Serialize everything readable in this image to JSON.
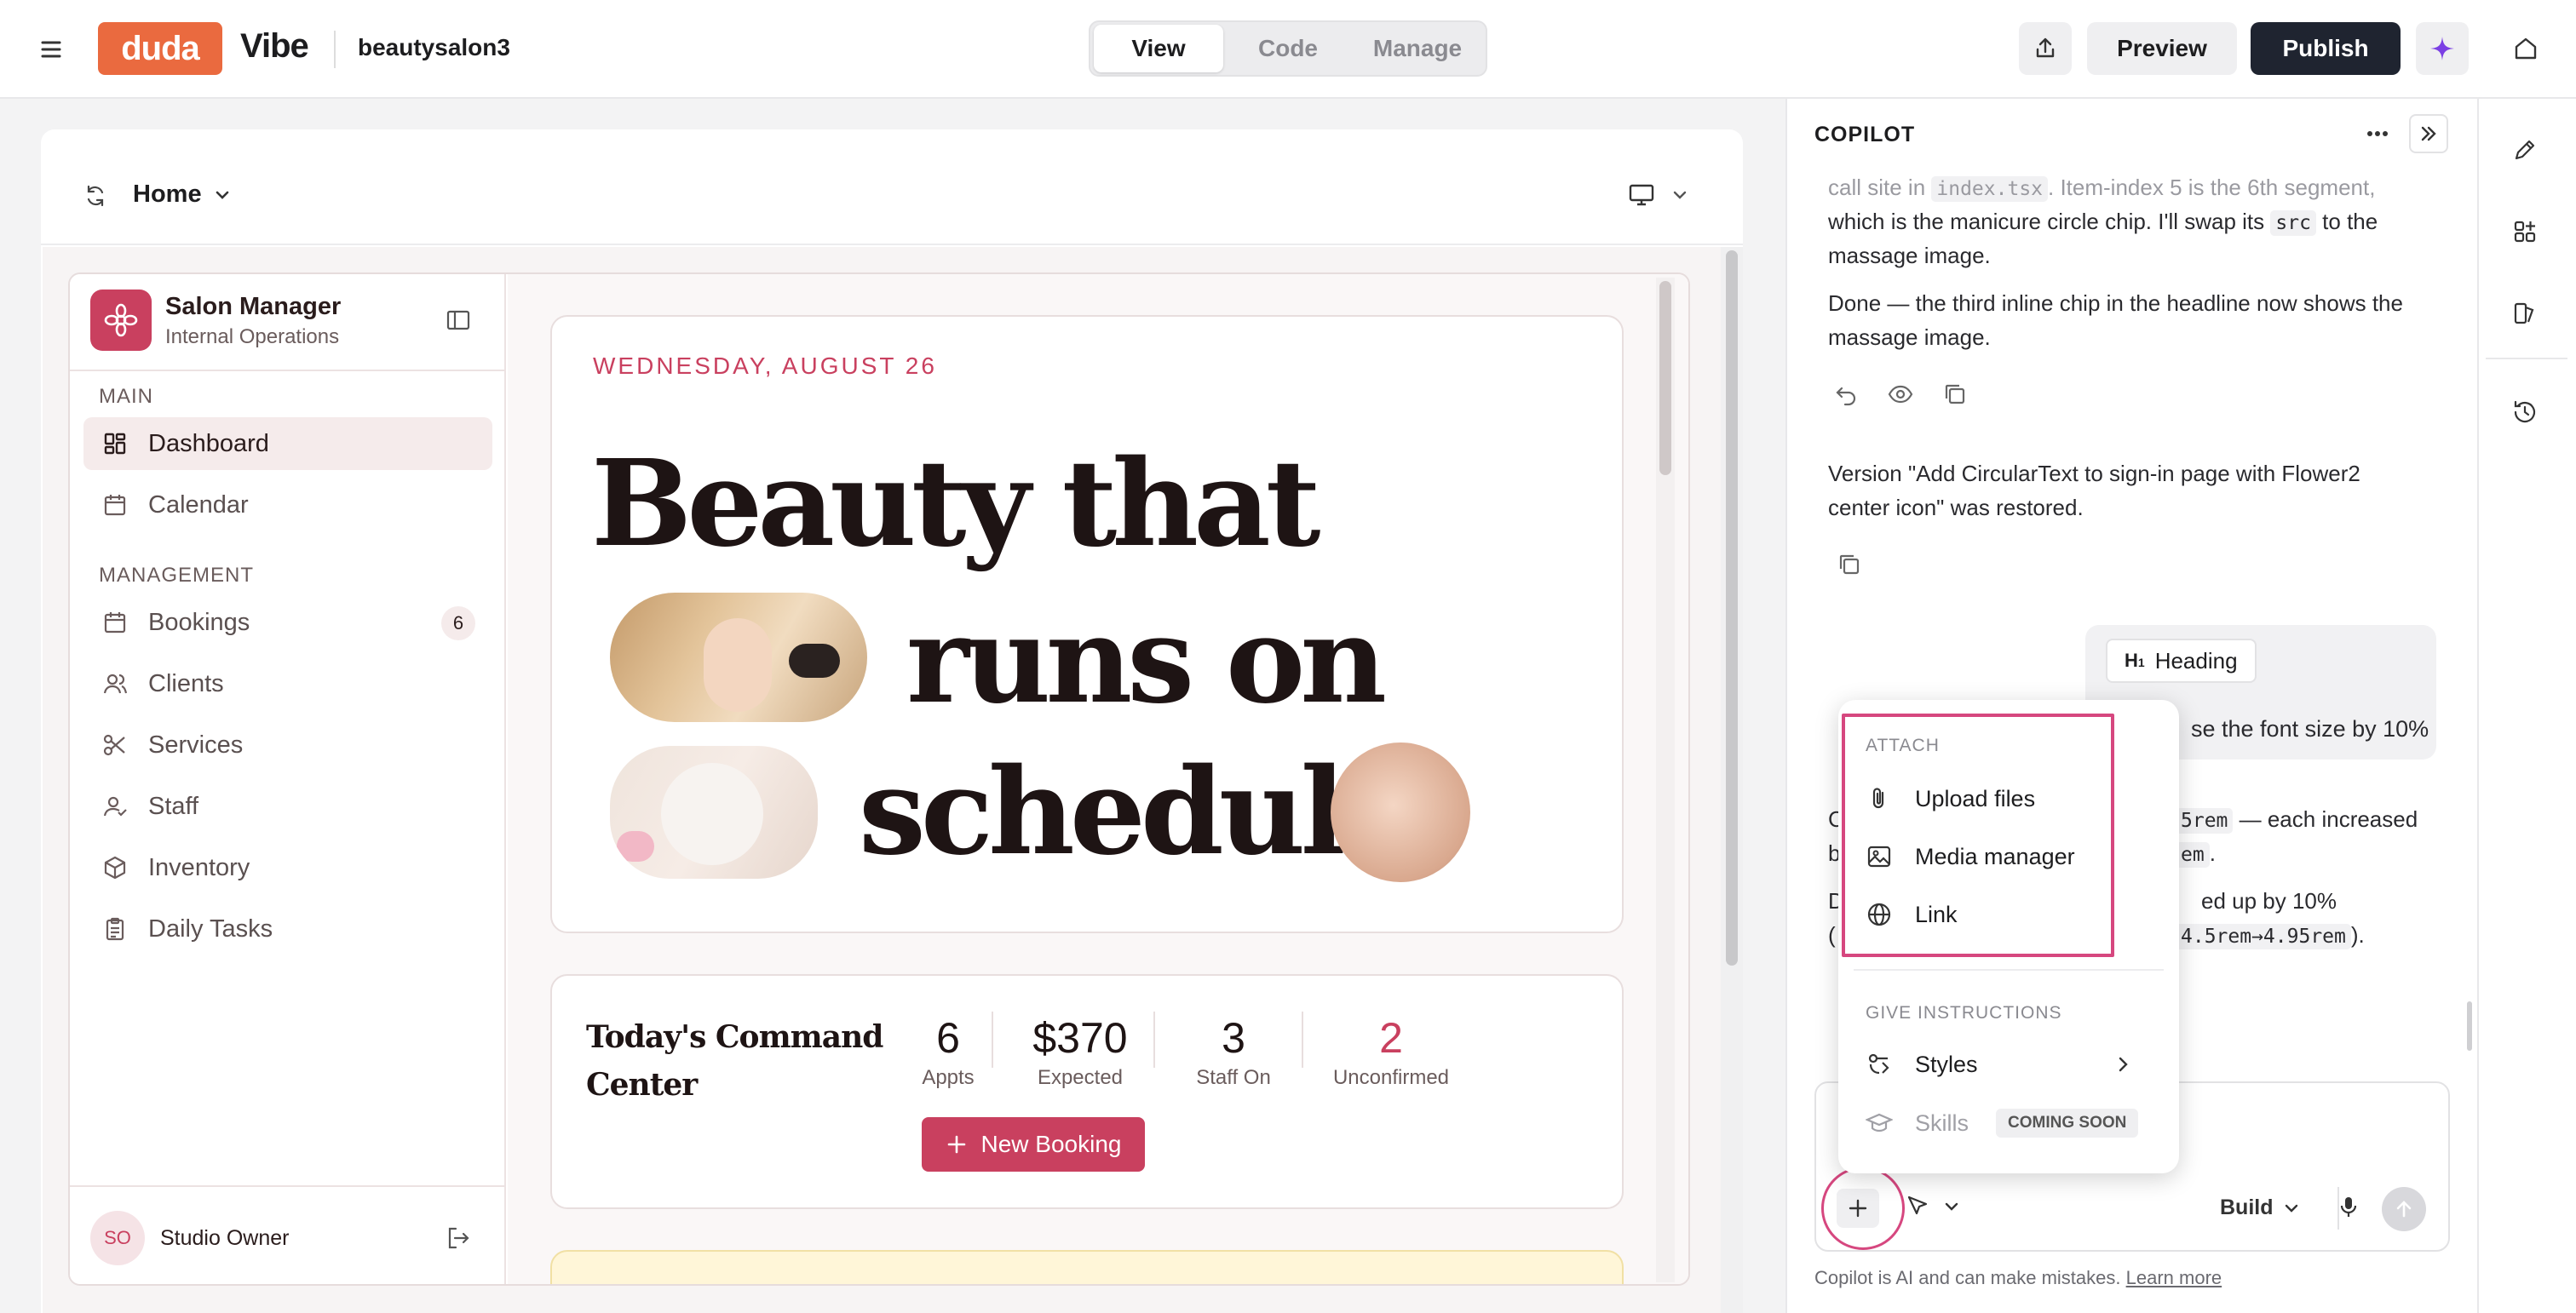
{
  "topbar": {
    "logo": "duda",
    "product": "Vibe",
    "site_name": "beautysalon3",
    "tabs": [
      "View",
      "Code",
      "Manage"
    ],
    "active_tab": "View",
    "preview_label": "Preview",
    "publish_label": "Publish"
  },
  "page_bar": {
    "page_name": "Home"
  },
  "salon_app": {
    "brand_title": "Salon Manager",
    "brand_subtitle": "Internal Operations",
    "section_main": "MAIN",
    "section_management": "MANAGEMENT",
    "nav": [
      {
        "label": "Dashboard",
        "icon": "dashboard-icon",
        "active": true
      },
      {
        "label": "Calendar",
        "icon": "calendar-icon"
      },
      {
        "label": "Bookings",
        "icon": "bookings-icon",
        "badge": "6"
      },
      {
        "label": "Clients",
        "icon": "clients-icon"
      },
      {
        "label": "Services",
        "icon": "scissors-icon"
      },
      {
        "label": "Staff",
        "icon": "staff-icon"
      },
      {
        "label": "Inventory",
        "icon": "box-icon"
      },
      {
        "label": "Daily Tasks",
        "icon": "clipboard-icon"
      }
    ],
    "user_initials": "SO",
    "user_name": "Studio Owner",
    "date_label": "WEDNESDAY, AUGUST 26",
    "headline_line1": "Beauty that",
    "headline_line2": "runs on",
    "headline_line3": "schedule",
    "command_title_1": "Today's Command",
    "command_title_2": "Center",
    "stats": [
      {
        "value": "6",
        "label": "Appts"
      },
      {
        "value": "$370",
        "label": "Expected"
      },
      {
        "value": "3",
        "label": "Staff On"
      },
      {
        "value": "2",
        "label": "Unconfirmed"
      }
    ],
    "new_booking_label": "New Booking"
  },
  "copilot": {
    "title": "COPILOT",
    "msg1_a": "call site in",
    "msg1_code1": "index.tsx",
    "msg1_b": ". Item-index 5 is the 6th segment,",
    "msg1_c": "which is the manicure circle chip. I'll swap its",
    "msg1_code2": "src",
    "msg1_d": "to the",
    "msg1_e": "massage image.",
    "msg2_a": "Done — the third inline chip in the headline now shows the",
    "msg2_b": "massage image.",
    "msg3_a": "Version \"Add CircularText to sign-in page with Flower2",
    "msg3_b": "center icon\" was restored.",
    "chip_label": "Heading",
    "user_msg_tail": "se the font size by 10%",
    "partial_1a": "C",
    "partial_1code": "5rem",
    "partial_1b": "— each increased",
    "partial_2a": "b",
    "partial_2code": "em",
    "partial_3a": "D",
    "partial_3b": "ed up by 10%",
    "partial_4a": "(",
    "partial_4code": "4.5rem→4.95rem",
    "partial_4b": ").",
    "mode_label": "Build",
    "disclaimer": "Copilot is AI and can make mistakes.",
    "learn_more": "Learn more"
  },
  "attach_menu": {
    "attach_header": "ATTACH",
    "upload_files": "Upload files",
    "media_manager": "Media manager",
    "link": "Link",
    "instructions_header": "GIVE INSTRUCTIONS",
    "styles": "Styles",
    "skills": "Skills",
    "coming_soon": "COMING SOON"
  },
  "colors": {
    "brand_orange": "#ea6a3f",
    "salon_rose": "#c9405f",
    "publish_dark": "#1f2430",
    "highlight": "#d6477f"
  }
}
